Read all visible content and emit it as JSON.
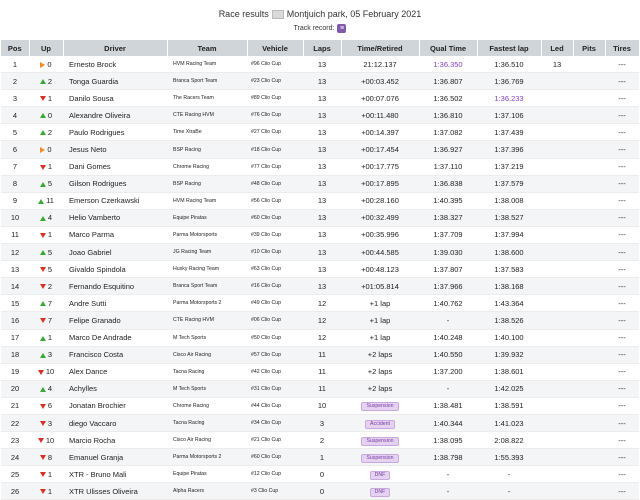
{
  "header": {
    "title_prefix": "Race results",
    "title_track": "Montjuich park, 05 February 2021",
    "track_record_label": "Track record:",
    "track_record_icon": "record-icon"
  },
  "columns": [
    "Pos",
    "Up",
    "Driver",
    "Team",
    "Vehicle",
    "Laps",
    "Time/Retired",
    "Qual Time",
    "Fastest lap",
    "Led",
    "Pits",
    "Tires"
  ],
  "colors": {
    "header_bg": "#cfd5d9",
    "up": "#3aa835",
    "down": "#d93025",
    "flat": "#f08a24",
    "purple": "#7e3fbf",
    "badge_bg": "#e4d2f0"
  },
  "rows": [
    {
      "pos": "1",
      "dir": "flat",
      "up": "0",
      "driver": "Ernesto Brock",
      "team": "HVM Racing Team",
      "vehicle": "#96 Ciio Cup",
      "laps": "13",
      "time": "21:12.137",
      "qual": "1:36.350",
      "qual_best": true,
      "fast": "1:36.510",
      "fast_best": false,
      "led": "13",
      "pits": "",
      "tires": "---"
    },
    {
      "pos": "2",
      "dir": "up",
      "up": "2",
      "driver": "Tonga Guardia",
      "team": "Branca Sport Team",
      "vehicle": "#23 Clio Cup",
      "laps": "13",
      "time": "+00:03.452",
      "qual": "1:36.807",
      "qual_best": false,
      "fast": "1:36.769",
      "fast_best": false,
      "led": "",
      "pits": "",
      "tires": "---"
    },
    {
      "pos": "3",
      "dir": "down",
      "up": "1",
      "driver": "Danilo Sousa",
      "team": "The Racers Team",
      "vehicle": "#89 Clio Cup",
      "laps": "13",
      "time": "+00:07.076",
      "qual": "1:36.502",
      "qual_best": false,
      "fast": "1:36.233",
      "fast_best": true,
      "led": "",
      "pits": "",
      "tires": "---"
    },
    {
      "pos": "4",
      "dir": "up",
      "up": "0",
      "driver": "Alexandre Oliveira",
      "team": "CTE Racing HVM",
      "vehicle": "#76 Clio Cup",
      "laps": "13",
      "time": "+00:11.480",
      "qual": "1:36.810",
      "qual_best": false,
      "fast": "1:37.106",
      "fast_best": false,
      "led": "",
      "pits": "",
      "tires": "---"
    },
    {
      "pos": "5",
      "dir": "up",
      "up": "2",
      "driver": "Paulo Rodrigues",
      "team": "Time XtraBe",
      "vehicle": "#27 Clio Cup",
      "laps": "13",
      "time": "+00:14.397",
      "qual": "1:37.082",
      "qual_best": false,
      "fast": "1:37.439",
      "fast_best": false,
      "led": "",
      "pits": "",
      "tires": "---"
    },
    {
      "pos": "6",
      "dir": "flat",
      "up": "0",
      "driver": "Jesus Neto",
      "team": "BSP Racing",
      "vehicle": "#18 Clio Cup",
      "laps": "13",
      "time": "+00:17.454",
      "qual": "1:36.927",
      "qual_best": false,
      "fast": "1:37.396",
      "fast_best": false,
      "led": "",
      "pits": "",
      "tires": "---"
    },
    {
      "pos": "7",
      "dir": "down",
      "up": "1",
      "driver": "Dani Gomes",
      "team": "Chrome Racing",
      "vehicle": "#77 Clio Cup",
      "laps": "13",
      "time": "+00:17.775",
      "qual": "1:37.110",
      "qual_best": false,
      "fast": "1:37.219",
      "fast_best": false,
      "led": "",
      "pits": "",
      "tires": "---"
    },
    {
      "pos": "8",
      "dir": "up",
      "up": "5",
      "driver": "Gilson Rodrigues",
      "team": "BSP Racing",
      "vehicle": "#48 Clio Cup",
      "laps": "13",
      "time": "+00:17.895",
      "qual": "1:36.838",
      "qual_best": false,
      "fast": "1:37.579",
      "fast_best": false,
      "led": "",
      "pits": "",
      "tires": "---"
    },
    {
      "pos": "9",
      "dir": "up",
      "up": "11",
      "driver": "Emerson Czerkawski",
      "team": "HVM Racing Team",
      "vehicle": "#56 Clio Cup",
      "laps": "13",
      "time": "+00:28.160",
      "qual": "1:40.395",
      "qual_best": false,
      "fast": "1:38.008",
      "fast_best": false,
      "led": "",
      "pits": "",
      "tires": "---"
    },
    {
      "pos": "10",
      "dir": "up",
      "up": "4",
      "driver": "Helio Vamberto",
      "team": "Equipe Piratas",
      "vehicle": "#60 Clio Cup",
      "laps": "13",
      "time": "+00:32.499",
      "qual": "1:38.327",
      "qual_best": false,
      "fast": "1:38.527",
      "fast_best": false,
      "led": "",
      "pits": "",
      "tires": "---"
    },
    {
      "pos": "11",
      "dir": "down",
      "up": "1",
      "driver": "Marco Parma",
      "team": "Parma Motorsports",
      "vehicle": "#39 Clio Cup",
      "laps": "13",
      "time": "+00:35.996",
      "qual": "1:37.709",
      "qual_best": false,
      "fast": "1:37.994",
      "fast_best": false,
      "led": "",
      "pits": "",
      "tires": "---"
    },
    {
      "pos": "12",
      "dir": "up",
      "up": "5",
      "driver": "Joao Gabriel",
      "team": "JG Racing Team",
      "vehicle": "#10 Clio Cup",
      "laps": "13",
      "time": "+00:44.585",
      "qual": "1:39.030",
      "qual_best": false,
      "fast": "1:38.600",
      "fast_best": false,
      "led": "",
      "pits": "",
      "tires": "---"
    },
    {
      "pos": "13",
      "dir": "down",
      "up": "5",
      "driver": "Givaldo Spindola",
      "team": "Husky Racing Team",
      "vehicle": "#63 Clio Cup",
      "laps": "13",
      "time": "+00:48.123",
      "qual": "1:37.807",
      "qual_best": false,
      "fast": "1:37.583",
      "fast_best": false,
      "led": "",
      "pits": "",
      "tires": "---"
    },
    {
      "pos": "14",
      "dir": "down",
      "up": "2",
      "driver": "Fernando Esquitino",
      "team": "Branca Sport Team",
      "vehicle": "#16 Clio Cup",
      "laps": "13",
      "time": "+01:05.814",
      "qual": "1:37.966",
      "qual_best": false,
      "fast": "1:38.168",
      "fast_best": false,
      "led": "",
      "pits": "",
      "tires": "---"
    },
    {
      "pos": "15",
      "dir": "up",
      "up": "7",
      "driver": "Andre Sutti",
      "team": "Parma Motorsports 2",
      "vehicle": "#49 Clio Cup",
      "laps": "12",
      "time": "+1 lap",
      "qual": "1:40.762",
      "qual_best": false,
      "fast": "1:43.364",
      "fast_best": false,
      "led": "",
      "pits": "",
      "tires": "---"
    },
    {
      "pos": "16",
      "dir": "down",
      "up": "7",
      "driver": "Felipe Granado",
      "team": "CTE Racing HVM",
      "vehicle": "#06 Clio Cup",
      "laps": "12",
      "time": "+1 lap",
      "qual": "-",
      "qual_best": false,
      "fast": "1:38.526",
      "fast_best": false,
      "led": "",
      "pits": "",
      "tires": "---"
    },
    {
      "pos": "17",
      "dir": "up",
      "up": "1",
      "driver": "Marco De Andrade",
      "team": "M Tech Sports",
      "vehicle": "#50 Clio Cup",
      "laps": "12",
      "time": "+1 lap",
      "qual": "1:40.248",
      "qual_best": false,
      "fast": "1:40.100",
      "fast_best": false,
      "led": "",
      "pits": "",
      "tires": "---"
    },
    {
      "pos": "18",
      "dir": "up",
      "up": "3",
      "driver": "Francisco Costa",
      "team": "Cisco Air Racing",
      "vehicle": "#57 Clio Cup",
      "laps": "11",
      "time": "+2 laps",
      "qual": "1:40.550",
      "qual_best": false,
      "fast": "1:39.932",
      "fast_best": false,
      "led": "",
      "pits": "",
      "tires": "---"
    },
    {
      "pos": "19",
      "dir": "down",
      "up": "10",
      "driver": "Alex Dance",
      "team": "Tacna Racing",
      "vehicle": "#42 Clio Cup",
      "laps": "11",
      "time": "+2 laps",
      "qual": "1:37.200",
      "qual_best": false,
      "fast": "1:38.601",
      "fast_best": false,
      "led": "",
      "pits": "",
      "tires": "---"
    },
    {
      "pos": "20",
      "dir": "up",
      "up": "4",
      "driver": "Achylles",
      "team": "M Tech Sports",
      "vehicle": "#31 Clio Cup",
      "laps": "11",
      "time": "+2 laps",
      "qual": "-",
      "qual_best": false,
      "fast": "1:42.025",
      "fast_best": false,
      "led": "",
      "pits": "",
      "tires": "---"
    },
    {
      "pos": "21",
      "dir": "down",
      "up": "6",
      "driver": "Jonatan Brochier",
      "team": "Chrome Racing",
      "vehicle": "#44 Clio Cup",
      "laps": "10",
      "time": "Suspension",
      "time_badge": true,
      "qual": "1:38.481",
      "qual_best": false,
      "fast": "1:38.591",
      "fast_best": false,
      "led": "",
      "pits": "",
      "tires": "---"
    },
    {
      "pos": "22",
      "dir": "down",
      "up": "3",
      "driver": "diego Vaccaro",
      "team": "Tacna Racing",
      "vehicle": "#34 Clio Cup",
      "laps": "3",
      "time": "Accident",
      "time_badge": true,
      "qual": "1:40.344",
      "qual_best": false,
      "fast": "1:41.023",
      "fast_best": false,
      "led": "",
      "pits": "",
      "tires": "---"
    },
    {
      "pos": "23",
      "dir": "down",
      "up": "10",
      "driver": "Marcio Rocha",
      "team": "Cisco Air Racing",
      "vehicle": "#21 Clio Cup",
      "laps": "2",
      "time": "Suspension",
      "time_badge": true,
      "qual": "1:38.095",
      "qual_best": false,
      "fast": "2:08.822",
      "fast_best": false,
      "led": "",
      "pits": "",
      "tires": "---"
    },
    {
      "pos": "24",
      "dir": "down",
      "up": "8",
      "driver": "Emanuel Granja",
      "team": "Parma Motorsports 2",
      "vehicle": "#60 Clio Cup",
      "laps": "1",
      "time": "Suspension",
      "time_badge": true,
      "qual": "1:38.798",
      "qual_best": false,
      "fast": "1:55.393",
      "fast_best": false,
      "led": "",
      "pits": "",
      "tires": "---"
    },
    {
      "pos": "25",
      "dir": "down",
      "up": "1",
      "driver": "XTR - Bruno Mali",
      "team": "Equipe Piratas",
      "vehicle": "#12 Clio Cup",
      "laps": "0",
      "time": "DNF",
      "time_badge": true,
      "qual": "-",
      "qual_best": false,
      "fast": "-",
      "fast_best": false,
      "led": "",
      "pits": "",
      "tires": "---"
    },
    {
      "pos": "26",
      "dir": "down",
      "up": "1",
      "driver": "XTR Ulisses Oliveira",
      "team": "Alpha Racers",
      "vehicle": "#3 Clio Cup",
      "laps": "0",
      "time": "DNF",
      "time_badge": true,
      "qual": "-",
      "qual_best": false,
      "fast": "-",
      "fast_best": false,
      "led": "",
      "pits": "",
      "tires": "---"
    }
  ]
}
